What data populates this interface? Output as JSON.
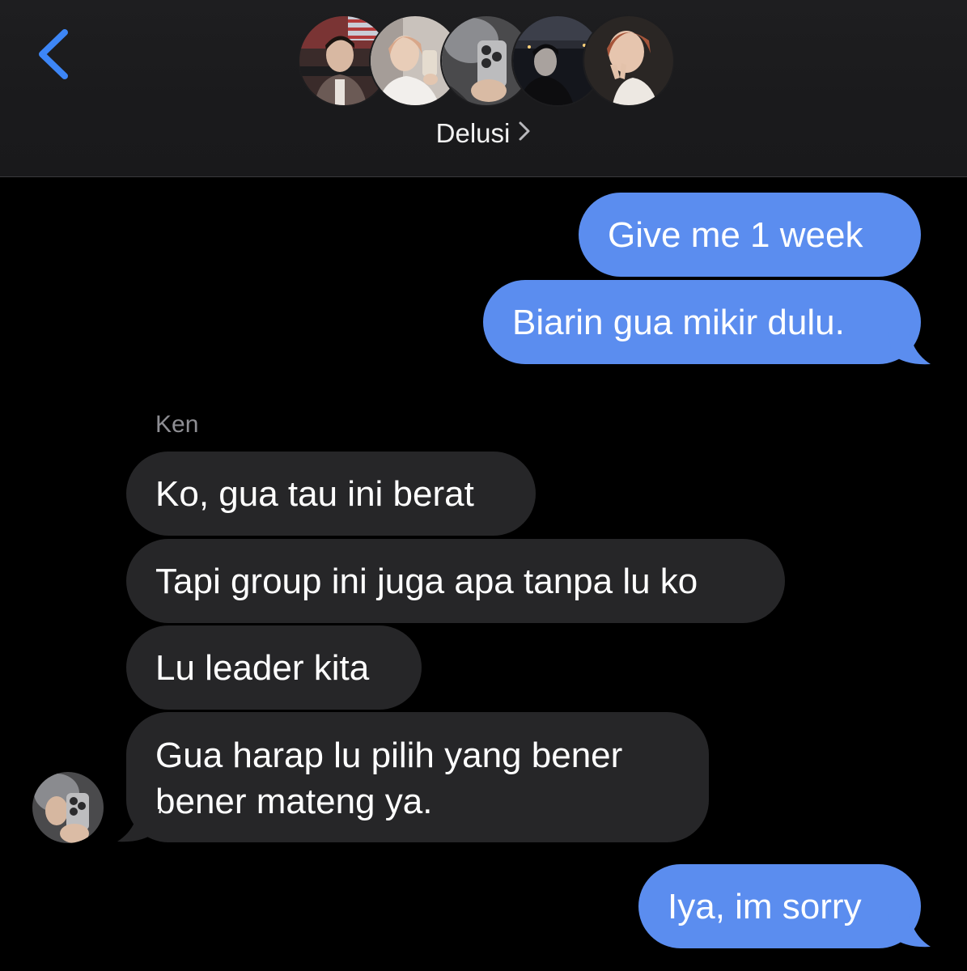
{
  "header": {
    "back_icon": "chevron-left-icon",
    "group_name": "Delusi",
    "chevron_icon": "chevron-right-icon",
    "member_avatars": [
      "member-avatar-1",
      "member-avatar-2",
      "member-avatar-3",
      "member-avatar-4",
      "member-avatar-5"
    ]
  },
  "colors": {
    "sent_bubble": "#5b8def",
    "received_bubble": "#262628",
    "accent": "#3d86f6",
    "background": "#000000",
    "sender_label": "#8e8e93"
  },
  "messages": [
    {
      "direction": "sent",
      "text": "Give me 1 week"
    },
    {
      "direction": "sent",
      "text": "Biarin gua mikir dulu."
    },
    {
      "direction": "received",
      "sender": "Ken",
      "text": "Ko, gua tau ini berat"
    },
    {
      "direction": "received",
      "sender": "Ken",
      "text": "Tapi group ini juga apa tanpa lu ko"
    },
    {
      "direction": "received",
      "sender": "Ken",
      "text": "Lu leader kita"
    },
    {
      "direction": "received",
      "sender": "Ken",
      "lines": [
        "Gua harap lu pilih yang bener",
        "bener mateng ya."
      ]
    },
    {
      "direction": "sent",
      "text": "Iya, im sorry"
    }
  ],
  "sender_label": "Ken"
}
